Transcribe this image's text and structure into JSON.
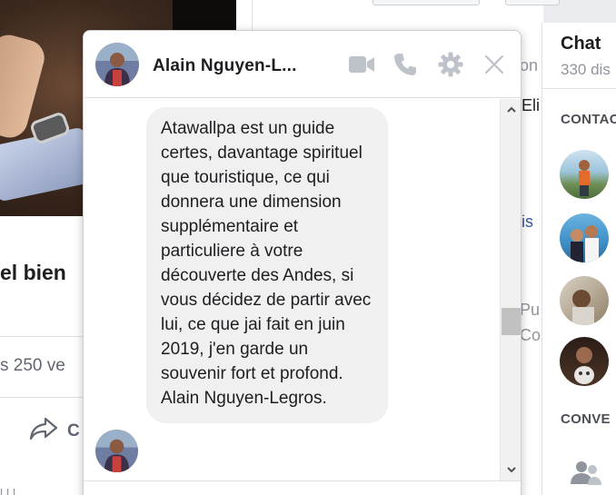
{
  "feed_post": {
    "headline": "el bien",
    "stats": "s  250 ve",
    "share_label": "C",
    "bottom_text": "l  l l"
  },
  "background": {
    "link_fragment": "n",
    "text_fragment_1": "on",
    "text_fragment_2": "Eli",
    "text_fragment_3": "is",
    "text_fragment_4": "Pu",
    "text_fragment_5": "Co"
  },
  "sidebar": {
    "title": "Chat",
    "subtitle": "330 dis",
    "contacts_header": "CONTAC",
    "conversations_header": "CONVE"
  },
  "chat_window": {
    "contact_name": "Alain Nguyen-L...",
    "message": "Atawallpa est un guide certes, davantage spirituel que touristique, ce qui donnera une dimension supplémentaire et particuliere à votre découverte des Andes, si vous décidez de partir avec lui, ce que jai fait en juin 2019, j'en garde un souvenir fort et profond. Alain Nguyen-Legros."
  },
  "icons": {
    "video": "video-camera-icon",
    "call": "phone-icon",
    "settings": "gear-icon",
    "close": "close-icon",
    "share": "share-arrow-icon",
    "group": "group-people-icon"
  },
  "colors": {
    "header_icon": "#bec2c9",
    "bubble_bg": "#f1f0f0",
    "link_blue": "#385898",
    "page_bg": "#e9ebee"
  }
}
